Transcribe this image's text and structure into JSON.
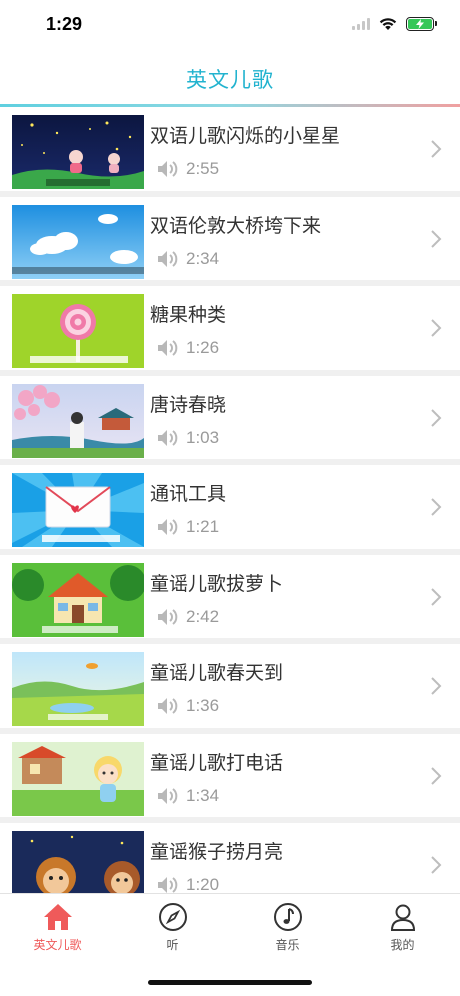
{
  "status_bar": {
    "time": "1:29",
    "battery_level": 1.0
  },
  "nav": {
    "title": "英文儿歌",
    "accent": "#22b3cf"
  },
  "songs": [
    {
      "title": "双语儿歌闪烁的小星星",
      "duration": "2:55",
      "thumb": "night-stars"
    },
    {
      "title": "双语伦敦大桥垮下来",
      "duration": "2:34",
      "thumb": "blue-sky-clouds"
    },
    {
      "title": "糖果种类",
      "duration": "1:26",
      "thumb": "lollipop"
    },
    {
      "title": "唐诗春晓",
      "duration": "1:03",
      "thumb": "blossom-pavilion"
    },
    {
      "title": "通讯工具",
      "duration": "1:21",
      "thumb": "envelope"
    },
    {
      "title": "童谣儿歌拔萝卜",
      "duration": "2:42",
      "thumb": "cottage"
    },
    {
      "title": "童谣儿歌春天到",
      "duration": "1:36",
      "thumb": "spring-meadow"
    },
    {
      "title": "童谣儿歌打电话",
      "duration": "1:34",
      "thumb": "girl-house"
    },
    {
      "title": "童谣猴子捞月亮",
      "duration": "1:20",
      "thumb": "monkeys"
    }
  ],
  "tabbar": {
    "tabs": [
      {
        "label": "英文儿歌",
        "icon": "house-icon",
        "active": true
      },
      {
        "label": "听",
        "icon": "compass-icon",
        "active": false
      },
      {
        "label": "音乐",
        "icon": "music-note-icon",
        "active": false
      },
      {
        "label": "我的",
        "icon": "person-icon",
        "active": false
      }
    ],
    "active_color": "#ef5a5a"
  }
}
